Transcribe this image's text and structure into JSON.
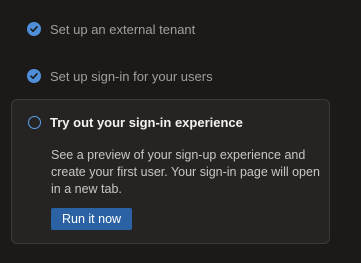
{
  "steps": [
    {
      "label": "Set up an external tenant",
      "status": "complete",
      "icon": "checkmark-circle-icon"
    },
    {
      "label": "Set up sign-in for your users",
      "status": "complete",
      "icon": "checkmark-circle-icon"
    }
  ],
  "current_step": {
    "title": "Try out your sign-in experience",
    "status": "in-progress",
    "icon": "empty-circle-icon",
    "description": "See a preview of your sign-up experience and create your first user. Your sign-in page will open in a new tab.",
    "action_label": "Run it now"
  },
  "colors": {
    "background": "#1b1a19",
    "card": "#252423",
    "accent": "#4f8fd9",
    "button": "#2a62a3"
  }
}
